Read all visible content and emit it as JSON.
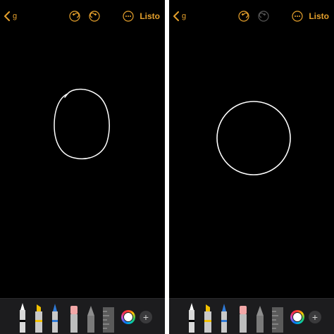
{
  "screens": [
    {
      "header": {
        "back_label": "g",
        "done_label": "Listo",
        "redo_enabled": true
      }
    },
    {
      "header": {
        "back_label": "g",
        "done_label": "Listo",
        "redo_enabled": false
      }
    }
  ],
  "colors": {
    "accent": "#e5a02c",
    "canvas": "#000000",
    "stroke": "#ffffff",
    "toolbar": "#1c1c1e",
    "disabled": "#555555"
  },
  "toolbar_icons": [
    "pen-icon",
    "marker-icon",
    "pencil-icon",
    "eraser-icon",
    "lasso-icon",
    "ruler-icon",
    "color-picker-icon",
    "add-icon"
  ],
  "add_label": "+"
}
